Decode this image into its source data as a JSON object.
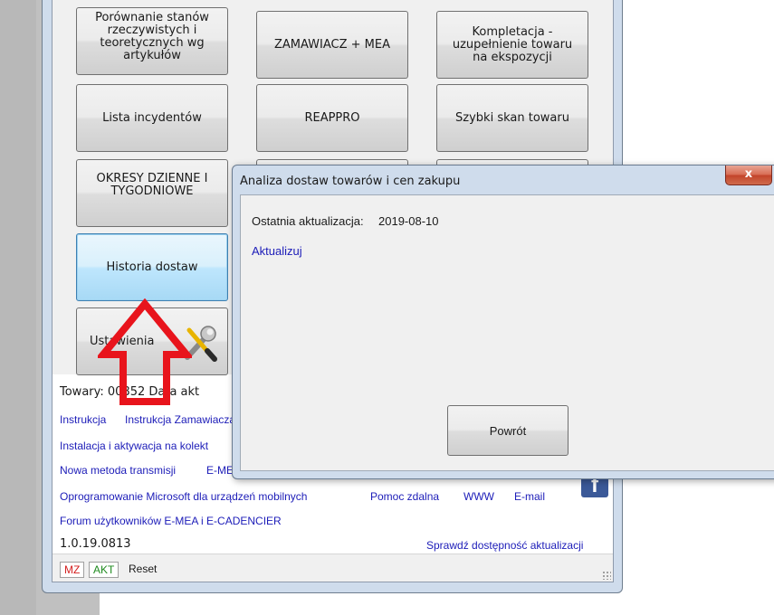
{
  "main_window": {
    "buttons": [
      {
        "label": "Porównanie stanów\nrzeczywistych i\nteoretycznych wg\nartykułów"
      },
      {
        "label": "ZAMAWIACZ + MEA"
      },
      {
        "label": "Kompletacja -\nuzupełnienie towaru\nna ekspozycji"
      },
      {
        "label": "Lista incydentów"
      },
      {
        "label": "REAPPRO"
      },
      {
        "label": "Szybki skan towaru"
      },
      {
        "label": "OKRESY DZIENNE I\nTYGODNIOWE"
      },
      {
        "label": "Historia dostaw"
      },
      {
        "label": "Ustawienia"
      }
    ],
    "info_line": {
      "partial_text": "Towary: 00852  Data akt"
    },
    "links": {
      "instrukcja": "Instrukcja",
      "instalacja_zamawiacza": "Instrukcja Zamawiacza",
      "instalacja_kolektor": "Instalacja i aktywacja  na kolekt",
      "nowa_metoda": "Nowa metoda transmisji",
      "emea_partial": "E-ME",
      "oprogramowanie": "Oprogramowanie Microsoft dla urządzeń mobilnych",
      "pomoc": "Pomoc zdalna",
      "www": "WWW",
      "email": "E-mail",
      "forum": "Forum użytkowników E-MEA i E-CADENCIER",
      "sprawdz": "Sprawdź dostępność aktualizacji"
    },
    "version": "1.0.19.0813",
    "statusbar": {
      "mz": "MZ",
      "akt": "AKT",
      "reset": "Reset"
    },
    "icons": {
      "facebook": "facebook-icon",
      "settings": "wrench-screwdriver-icon"
    }
  },
  "dialog": {
    "title": "Analiza dostaw towarów i cen zakupu",
    "close_label": "x",
    "last_update_label": "Ostatnia aktualizacja:",
    "last_update_value": "2019-08-10",
    "update_link": "Aktualizuj",
    "back_button": "Powrót"
  },
  "colors": {
    "link": "#1c1cb8",
    "arrow": "#e8141c",
    "mz": "#d41e1e",
    "akt": "#1e8a1e",
    "focus_border": "#3c7fb1"
  }
}
